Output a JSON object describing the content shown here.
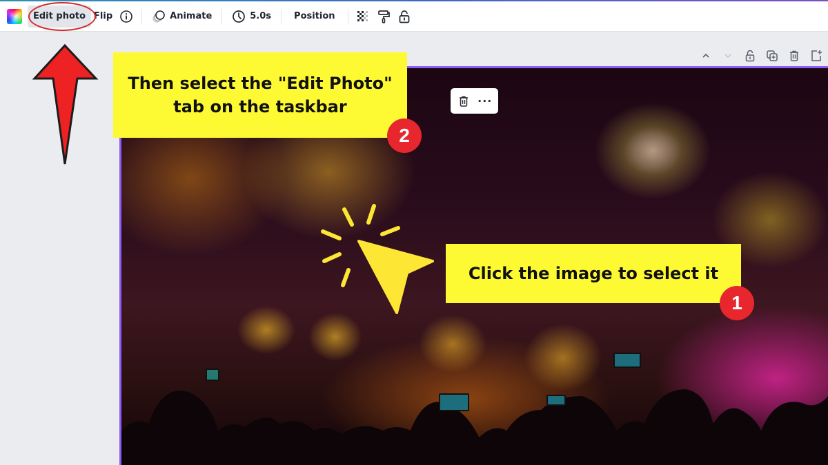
{
  "toolbar": {
    "color_icon": "color-palette-swatch",
    "edit_photo_label": "Edit photo",
    "flip_label": "Flip",
    "info_icon": "info-icon",
    "animate_label": "Animate",
    "duration_label": "5.0s",
    "position_label": "Position",
    "transparency_icon": "checkerboard-transparency-icon",
    "copy_style_icon": "paint-roller-icon",
    "lock_icon": "unlock-icon"
  },
  "page_controls": {
    "items": [
      "move-up",
      "move-down",
      "lock-page",
      "duplicate-page",
      "delete-page",
      "add-page"
    ]
  },
  "floating_menu": {
    "delete_icon": "trash-icon",
    "more_label": "···"
  },
  "annotations": {
    "callout_step2": "Then select the \"Edit Photo\" tab on the taskbar",
    "callout_step1": "Click the image to select it",
    "badge_step2": "2",
    "badge_step1": "1"
  },
  "colors": {
    "callout_bg": "#fdfa33",
    "badge_bg": "#e8262d",
    "selection_border": "#8b5cf6",
    "arrow_fill": "#ee2222",
    "highlight_ellipse": "#d32a2a"
  }
}
